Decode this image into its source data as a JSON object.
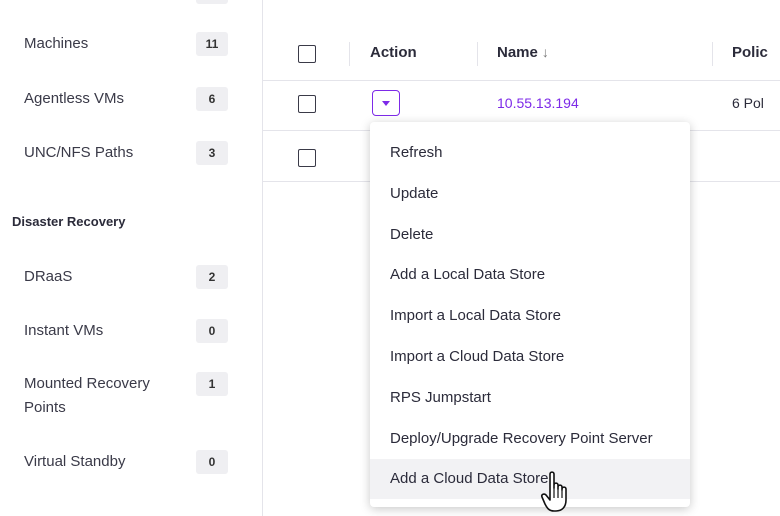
{
  "sidebar": {
    "items": [
      {
        "label": "Machines",
        "count": "11"
      },
      {
        "label": "Agentless VMs",
        "count": "6"
      },
      {
        "label": "UNC/NFS Paths",
        "count": "3"
      }
    ],
    "section_heading": "Disaster Recovery",
    "dr_items": [
      {
        "label": "DRaaS",
        "count": "2"
      },
      {
        "label": "Instant VMs",
        "count": "0"
      },
      {
        "label": "Mounted Recovery Points",
        "count": "1"
      },
      {
        "label": "Virtual Standby",
        "count": "0"
      }
    ]
  },
  "table": {
    "headers": {
      "action": "Action",
      "name": "Name",
      "sort_symbol": "↓",
      "policy": "Polic"
    },
    "rows": [
      {
        "name": "10.55.13.194",
        "policy": "6 Pol"
      }
    ]
  },
  "menu": {
    "items": [
      "Refresh",
      "Update",
      "Delete",
      "Add a Local Data Store",
      "Import a Local Data Store",
      "Import a Cloud Data Store",
      "RPS Jumpstart",
      "Deploy/Upgrade Recovery Point Server",
      "Add a Cloud Data Store"
    ],
    "hovered_index": 8
  },
  "colors": {
    "accent": "#7d2ae8",
    "hover": "#f2f2f4",
    "border": "#e4e4ea"
  },
  "icons": {
    "dropdown": "caret-down-icon",
    "sort": "arrow-down-icon",
    "pointer": "hand-cursor-icon"
  }
}
